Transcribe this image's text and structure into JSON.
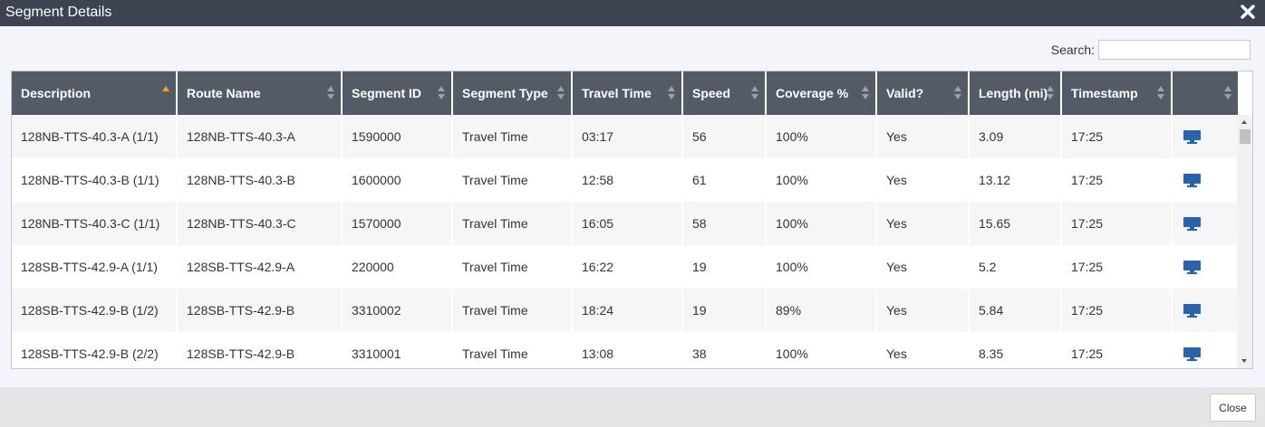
{
  "dialog": {
    "title": "Segment Details",
    "close_icon": "close-x-icon"
  },
  "search": {
    "label": "Search:",
    "value": "",
    "placeholder": ""
  },
  "table": {
    "columns": [
      {
        "label": "Description",
        "sort": "asc"
      },
      {
        "label": "Route Name",
        "sort": "none"
      },
      {
        "label": "Segment ID",
        "sort": "none"
      },
      {
        "label": "Segment Type",
        "sort": "none"
      },
      {
        "label": "Travel Time",
        "sort": "none"
      },
      {
        "label": "Speed",
        "sort": "none"
      },
      {
        "label": "Coverage %",
        "sort": "none"
      },
      {
        "label": "Valid?",
        "sort": "none"
      },
      {
        "label": "Length (mi)",
        "sort": "none"
      },
      {
        "label": "Timestamp",
        "sort": "none"
      },
      {
        "label": "",
        "sort": "none"
      }
    ],
    "rows": [
      {
        "description": "128NB-TTS-40.3-A (1/1)",
        "route": "128NB-TTS-40.3-A",
        "segment_id": "1590000",
        "type": "Travel Time",
        "travel_time": "03:17",
        "speed": "56",
        "coverage": "100%",
        "valid": "Yes",
        "length": "3.09",
        "timestamp": "17:25",
        "icon": "monitor-icon"
      },
      {
        "description": "128NB-TTS-40.3-B (1/1)",
        "route": "128NB-TTS-40.3-B",
        "segment_id": "1600000",
        "type": "Travel Time",
        "travel_time": "12:58",
        "speed": "61",
        "coverage": "100%",
        "valid": "Yes",
        "length": "13.12",
        "timestamp": "17:25",
        "icon": "monitor-icon"
      },
      {
        "description": "128NB-TTS-40.3-C (1/1)",
        "route": "128NB-TTS-40.3-C",
        "segment_id": "1570000",
        "type": "Travel Time",
        "travel_time": "16:05",
        "speed": "58",
        "coverage": "100%",
        "valid": "Yes",
        "length": "15.65",
        "timestamp": "17:25",
        "icon": "monitor-icon"
      },
      {
        "description": "128SB-TTS-42.9-A (1/1)",
        "route": "128SB-TTS-42.9-A",
        "segment_id": "220000",
        "type": "Travel Time",
        "travel_time": "16:22",
        "speed": "19",
        "coverage": "100%",
        "valid": "Yes",
        "length": "5.2",
        "timestamp": "17:25",
        "icon": "monitor-icon"
      },
      {
        "description": "128SB-TTS-42.9-B (1/2)",
        "route": "128SB-TTS-42.9-B",
        "segment_id": "3310002",
        "type": "Travel Time",
        "travel_time": "18:24",
        "speed": "19",
        "coverage": "89%",
        "valid": "Yes",
        "length": "5.84",
        "timestamp": "17:25",
        "icon": "monitor-icon"
      },
      {
        "description": "128SB-TTS-42.9-B (2/2)",
        "route": "128SB-TTS-42.9-B",
        "segment_id": "3310001",
        "type": "Travel Time",
        "travel_time": "13:08",
        "speed": "38",
        "coverage": "100%",
        "valid": "Yes",
        "length": "8.35",
        "timestamp": "17:25",
        "icon": "monitor-icon"
      }
    ]
  },
  "footer": {
    "close_label": "Close"
  },
  "colors": {
    "titlebar": "#3d4451",
    "header": "#535b66",
    "sort_active": "#f0a030",
    "icon_blue": "#2b62a8"
  }
}
